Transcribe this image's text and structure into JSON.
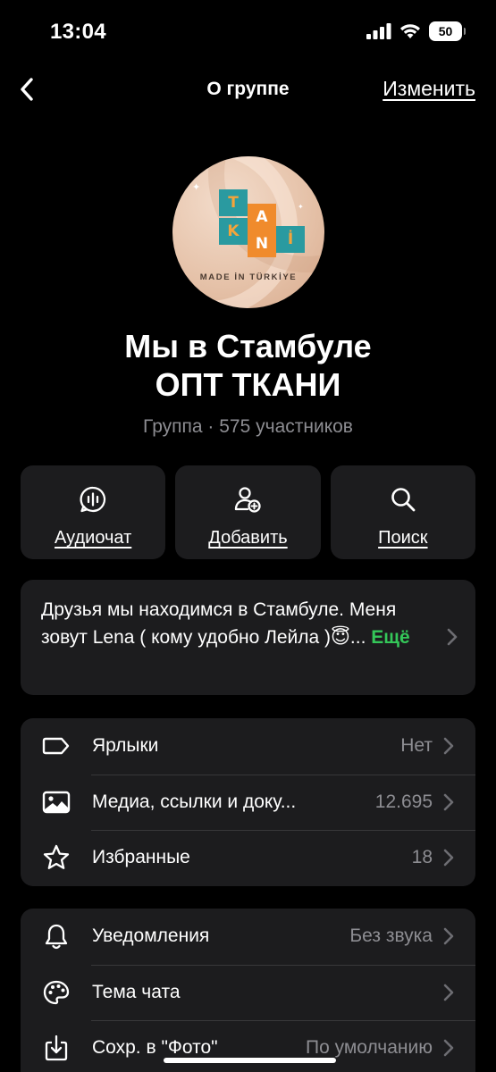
{
  "status_bar": {
    "time": "13:04",
    "battery": "50"
  },
  "nav": {
    "title": "О группе",
    "edit_label": "Изменить"
  },
  "avatar": {
    "tiles": [
      "T",
      "A",
      "K",
      "N",
      "İ"
    ],
    "caption": "MADE İN TÜRKİYE"
  },
  "group": {
    "name_line1": "Мы в Стамбуле",
    "name_line2": "ОПТ ТКАНИ",
    "meta": "Группа · 575 участников"
  },
  "actions": [
    {
      "label": "Аудиочат",
      "icon": "audio-chat-icon"
    },
    {
      "label": "Добавить",
      "icon": "add-member-icon"
    },
    {
      "label": "Поиск",
      "icon": "search-icon"
    }
  ],
  "description": {
    "text": "Друзья мы находимся в Стамбуле. Меня зовут Lena  ( кому удобно Лейла )😇...",
    "more_label": "Ещё"
  },
  "list1": [
    {
      "label": "Ярлыки",
      "value": "Нет",
      "icon": "label-tag-icon"
    },
    {
      "label": "Медиа, ссылки и доку...",
      "value": "12.695",
      "icon": "media-image-icon"
    },
    {
      "label": "Избранные",
      "value": "18",
      "icon": "star-icon"
    }
  ],
  "list2": [
    {
      "label": "Уведомления",
      "value": "Без звука",
      "icon": "bell-icon"
    },
    {
      "label": "Тема чата",
      "value": "",
      "icon": "palette-icon"
    },
    {
      "label": "Сохр. в \"Фото\"",
      "value": "По умолчанию",
      "icon": "save-download-icon"
    }
  ],
  "colors": {
    "background": "#000000",
    "card": "#1c1c1e",
    "secondary_text": "#8d8d92",
    "accent_more": "#34c759"
  }
}
